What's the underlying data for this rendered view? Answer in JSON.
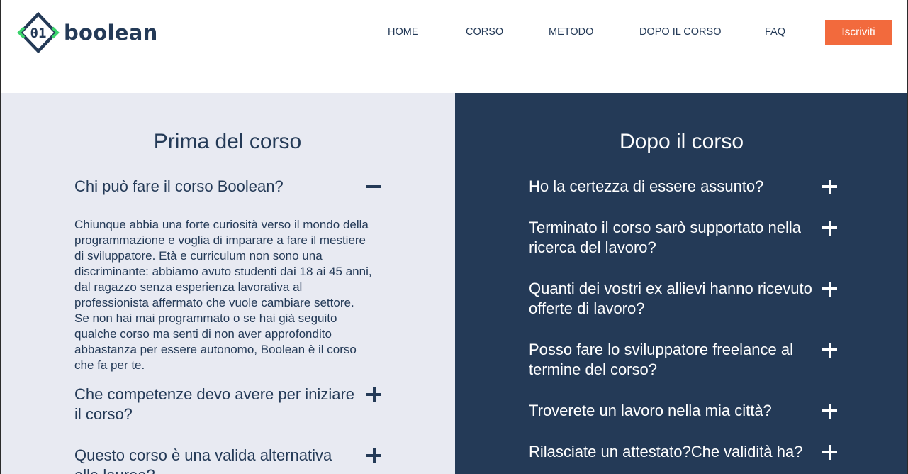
{
  "brand": {
    "logo_mark": "01",
    "name": "boolean",
    "colors": {
      "navy": "#243a57",
      "green": "#3bd46c",
      "orange": "#f26a3d",
      "light_panel": "#e8eaf2"
    }
  },
  "nav": {
    "items": [
      "HOME",
      "CORSO",
      "METODO",
      "DOPO IL CORSO",
      "FAQ"
    ],
    "cta": "Iscriviti"
  },
  "before": {
    "title": "Prima del corso",
    "faqs": [
      {
        "question": "Chi può fare il corso Boolean?",
        "expanded": true,
        "icon": "minus-icon",
        "answer": "Chiunque abbia una forte curiosità verso il mondo della programmazione e voglia di imparare a fare il mestiere di sviluppatore. Età e curriculum non sono una discriminante: abbiamo avuto studenti dai 18 ai 45 anni, dal ragazzo senza esperienza lavorativa al professionista affermato che vuole cambiare settore. Se non hai mai programmato o se hai già seguito qualche corso ma senti di non aver approfondito abbastanza per essere autonomo, Boolean è il corso che fa per te."
      },
      {
        "question": "Che competenze devo avere per iniziare il corso?",
        "expanded": false,
        "icon": "plus-icon"
      },
      {
        "question": "Questo corso è una valida alternativa alla laurea?",
        "expanded": false,
        "icon": "plus-icon"
      }
    ]
  },
  "after": {
    "title": "Dopo il corso",
    "faqs": [
      {
        "question": "Ho la certezza di essere assunto?",
        "expanded": false,
        "icon": "plus-icon"
      },
      {
        "question": "Terminato il corso sarò supportato nella ricerca del lavoro?",
        "expanded": false,
        "icon": "plus-icon"
      },
      {
        "question": "Quanti dei vostri ex allievi hanno ricevuto offerte di lavoro?",
        "expanded": false,
        "icon": "plus-icon"
      },
      {
        "question": "Posso fare lo sviluppatore freelance al termine del corso?",
        "expanded": false,
        "icon": "plus-icon"
      },
      {
        "question": "Troverete un lavoro nella mia città?",
        "expanded": false,
        "icon": "plus-icon"
      },
      {
        "question": "Rilasciate un attestato?Che validità ha?",
        "expanded": false,
        "icon": "plus-icon"
      }
    ]
  }
}
